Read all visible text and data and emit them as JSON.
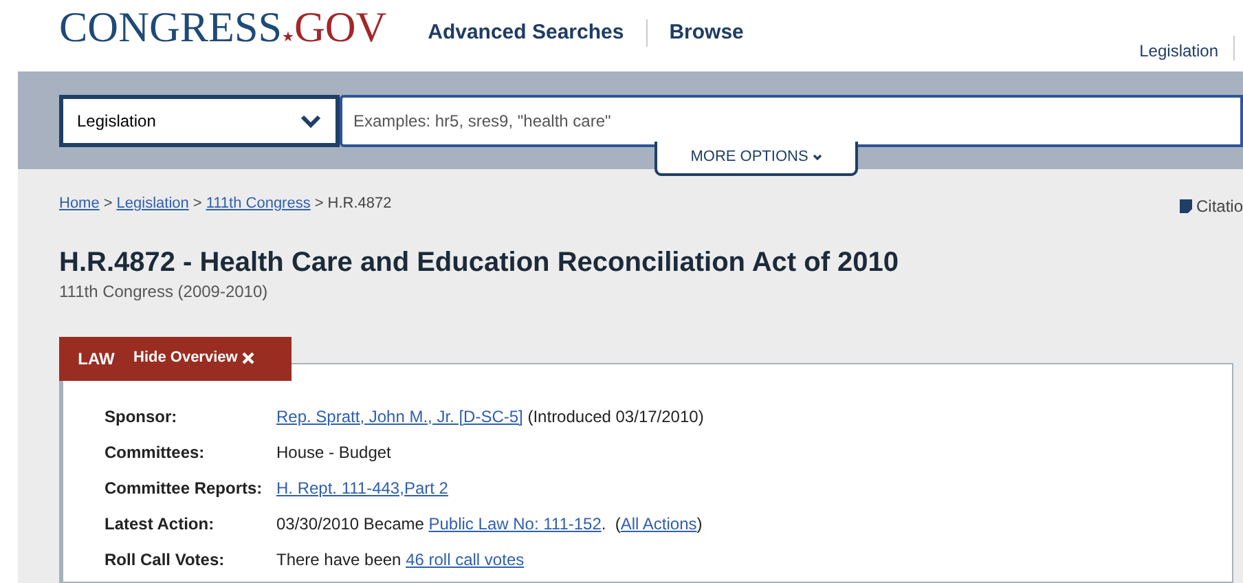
{
  "header": {
    "logo_main": "CONGRESS",
    "logo_dot": "★",
    "logo_suffix": "GOV",
    "nav": [
      "Advanced Searches",
      "Browse"
    ],
    "right_link": "Legislation"
  },
  "search": {
    "scope": "Legislation",
    "placeholder": "Examples: hr5, sres9, \"health care\"",
    "more_options": "MORE OPTIONS"
  },
  "breadcrumbs": [
    {
      "text": "Home",
      "kind": "link"
    },
    {
      "text": "Legislation",
      "kind": "link"
    },
    {
      "text": "111th Congress",
      "kind": "link"
    },
    {
      "text": "H.R.4872",
      "kind": "current"
    }
  ],
  "separator": ">",
  "citation": "Citatio",
  "bill": {
    "title": "H.R.4872 - Health Care and Education Reconciliation Act of 2010",
    "congress": "111th Congress (2009-2010)"
  },
  "tabs": {
    "status": "LAW",
    "hide_overview": "Hide Overview"
  },
  "overview": [
    {
      "label": "Sponsor:",
      "parts": [
        {
          "text": "Rep. Spratt, John M., Jr. [D-SC-5]",
          "kind": "link"
        },
        {
          "text": " (Introduced 03/17/2010)",
          "kind": "text"
        }
      ]
    },
    {
      "label": "Committees:",
      "parts": [
        {
          "text": "House - Budget",
          "kind": "text"
        }
      ]
    },
    {
      "label": "Committee Reports:",
      "parts": [
        {
          "text": "H. Rept. 111-443,Part 2",
          "kind": "link"
        }
      ]
    },
    {
      "label": "Latest Action:",
      "parts": [
        {
          "text": "03/30/2010 Became ",
          "kind": "text"
        },
        {
          "text": "Public Law No: 111-152",
          "kind": "link"
        },
        {
          "text": ".  (",
          "kind": "text"
        },
        {
          "text": "All Actions",
          "kind": "link"
        },
        {
          "text": ")",
          "kind": "text"
        }
      ]
    },
    {
      "label": "Roll Call Votes:",
      "parts": [
        {
          "text": "There have been ",
          "kind": "text"
        },
        {
          "text": "46 roll call votes",
          "kind": "link"
        }
      ]
    }
  ]
}
